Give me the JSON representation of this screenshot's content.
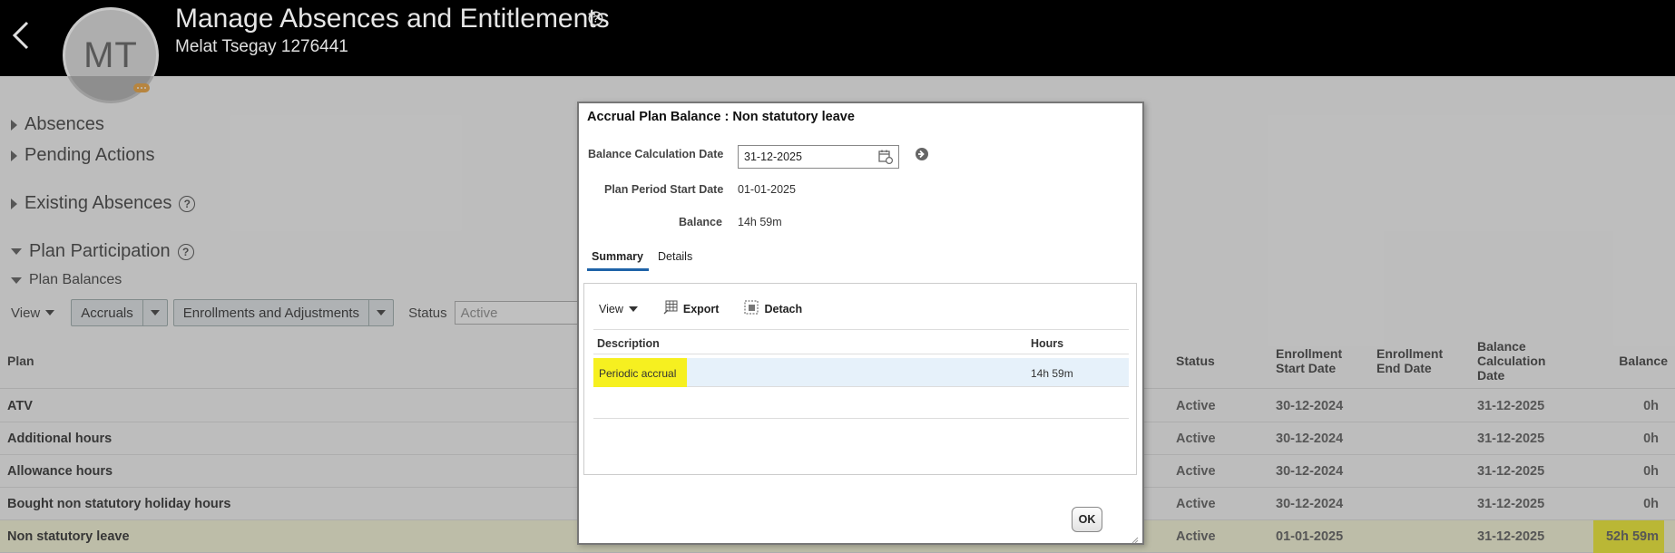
{
  "header": {
    "title": "Manage Absences and Entitlements",
    "avatar_initials": "MT",
    "person": "Melat Tsegay 1276441"
  },
  "sections": {
    "absences": "Absences",
    "pending_actions": "Pending Actions",
    "existing_absences": "Existing Absences",
    "plan_participation": "Plan Participation",
    "plan_balances": "Plan Balances"
  },
  "toolbar": {
    "view_label": "View",
    "accruals": "Accruals",
    "enrollments": "Enrollments and Adjustments",
    "status_label": "Status",
    "status_value": "Active"
  },
  "table": {
    "headers": {
      "plan": "Plan",
      "status": "Status",
      "enroll_start_1": "Enrollment",
      "enroll_start_2": "Start Date",
      "enroll_end_1": "Enrollment",
      "enroll_end_2": "End Date",
      "bcd_1": "Balance",
      "bcd_2": "Calculation",
      "bcd_3": "Date",
      "balance": "Balance"
    },
    "rows": [
      {
        "plan": "ATV",
        "status": "Active",
        "start": "30-12-2024",
        "calc": "31-12-2025",
        "balance": "0h"
      },
      {
        "plan": "Additional hours",
        "status": "Active",
        "start": "30-12-2024",
        "calc": "31-12-2025",
        "balance": "0h"
      },
      {
        "plan": "Allowance hours",
        "status": "Active",
        "start": "30-12-2024",
        "calc": "31-12-2025",
        "balance": "0h"
      },
      {
        "plan": "Bought non statutory holiday hours",
        "status": "Active",
        "start": "30-12-2024",
        "calc": "31-12-2025",
        "balance": "0h"
      },
      {
        "plan": "Non statutory leave",
        "status": "Active",
        "start": "01-01-2025",
        "calc": "31-12-2025",
        "balance": "52h 59m"
      }
    ]
  },
  "dialog": {
    "title": "Accrual Plan Balance : Non statutory leave",
    "calc_date_label": "Balance Calculation Date",
    "calc_date_value": "31-12-2025",
    "period_start_label": "Plan Period Start Date",
    "period_start_value": "01-01-2025",
    "balance_label": "Balance",
    "balance_value": "14h 59m",
    "tabs": {
      "summary": "Summary",
      "details": "Details"
    },
    "panel_toolbar": {
      "view": "View",
      "export": "Export",
      "detach": "Detach"
    },
    "inner_headers": {
      "description": "Description",
      "hours": "Hours"
    },
    "inner_rows": [
      {
        "description": "Periodic accrual",
        "hours": "14h 59m"
      }
    ],
    "ok": "OK"
  },
  "colors": {
    "header_bg": "#000000",
    "highlight": "#f6f020",
    "tab_accent": "#1f63a8",
    "selected_row": "#e6f1fa"
  }
}
